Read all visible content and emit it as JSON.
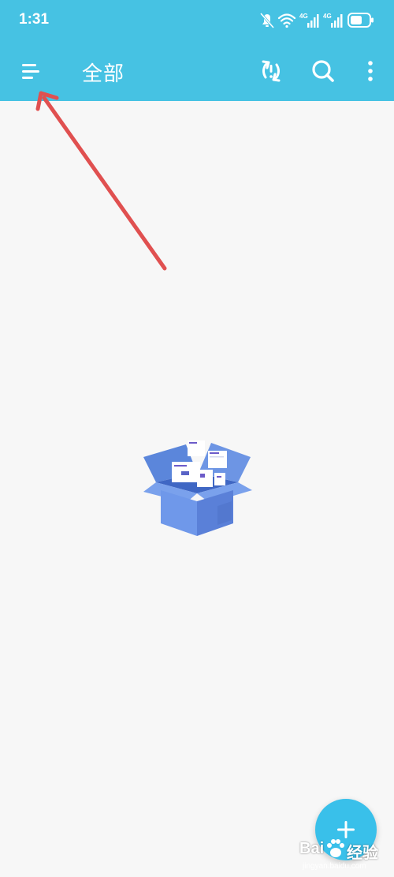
{
  "status_bar": {
    "time": "1:31",
    "network_1": "4G",
    "network_2": "4G",
    "icons": [
      "mute-icon",
      "wifi-icon",
      "signal-icon",
      "signal-icon",
      "battery-icon"
    ]
  },
  "app_bar": {
    "title": "全部",
    "menu_icon": "menu-icon",
    "actions": [
      "sync-icon",
      "search-icon",
      "more-vert-icon"
    ]
  },
  "empty_state": {
    "illustration": "empty-box-icon"
  },
  "fab": {
    "icon": "plus-icon"
  },
  "watermark": {
    "brand": "Bai",
    "brand_cn": "经验",
    "url": "jingyan.baidu.com"
  },
  "colors": {
    "primary": "#46c2e3",
    "fab": "#39c0ea",
    "background": "#f7f7f7",
    "annotation_arrow": "#e05050"
  }
}
